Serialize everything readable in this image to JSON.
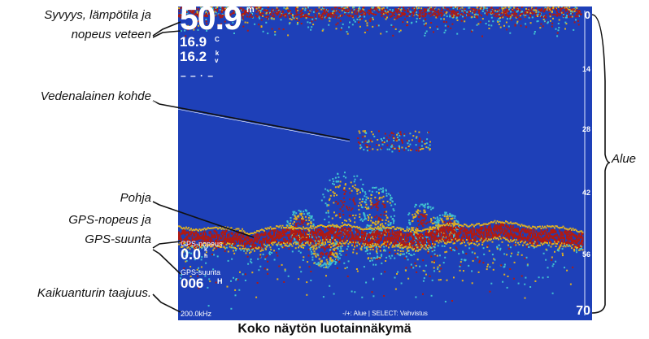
{
  "callouts": {
    "depth_line1": "Syvyys, lämpötila ja",
    "depth_line2": "nopeus veteen",
    "target": "Vedenalainen kohde",
    "bottom": "Pohja",
    "gps_line1": "GPS-nopeus ja",
    "gps_line2": "GPS-suunta",
    "freq": "Kaikuanturin taajuus.",
    "range": "Alue"
  },
  "screen": {
    "depth": "50.9",
    "depth_unit": "m",
    "temperature": "16.9",
    "temperature_unit": "C",
    "speed": "16.2",
    "speed_unit_top": "k",
    "speed_unit_bottom": "v",
    "gps_speed_label": "GPS-nopeus",
    "gps_speed": "0.0",
    "gps_speed_unit_top": "k",
    "gps_speed_unit_bottom": "h",
    "gps_heading_label": "GPS-suunta",
    "gps_heading": "006",
    "gps_heading_unit": "H",
    "frequency": "200.0kHz",
    "hint": "-/+: Alue | SELECT: Vahvistus",
    "scale": [
      "0",
      "14",
      "28",
      "42",
      "56",
      "70"
    ]
  },
  "colors": {
    "water": "#1e40b8",
    "return_strong": "#b01a12",
    "return_mid": "#e0b020",
    "return_weak": "#40c0d0"
  },
  "caption": "Koko näytön luotainnäkymä"
}
